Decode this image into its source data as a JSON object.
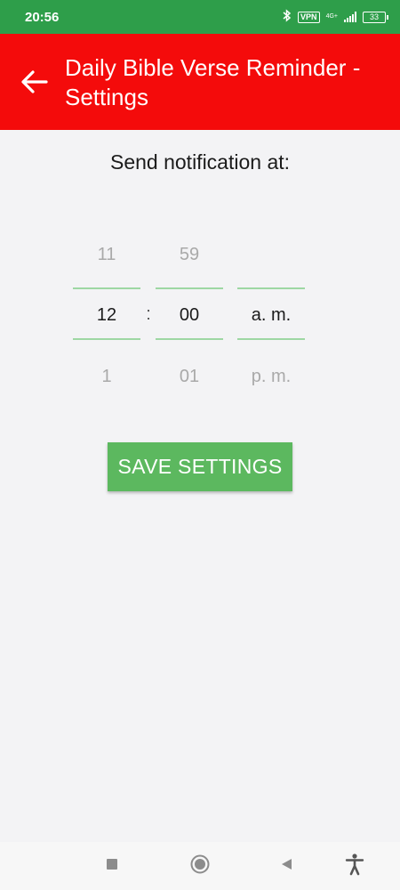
{
  "status_bar": {
    "time": "20:56",
    "vpn": "VPN",
    "network": "4G+",
    "battery": "33",
    "icons": [
      "bluetooth-icon",
      "vpn-icon",
      "signal-icon",
      "battery-icon"
    ]
  },
  "app_bar": {
    "title": "Daily Bible Verse Reminder - Settings",
    "back_icon": "arrow-left-icon",
    "color": "#f40b0b"
  },
  "settings": {
    "prompt": "Send notification at:",
    "time_picker": {
      "hour": {
        "prev": "11",
        "current": "12",
        "next": "1"
      },
      "separator": ":",
      "minute": {
        "prev": "59",
        "current": "00",
        "next": "01"
      },
      "period": {
        "prev": "",
        "current": "a. m.",
        "next": "p. m."
      }
    },
    "save_label": "SAVE SETTINGS",
    "save_color": "#5cb85f"
  },
  "nav_bar": {
    "icons": [
      "recents-square-icon",
      "home-circle-icon",
      "back-triangle-icon",
      "accessibility-icon"
    ]
  },
  "colors": {
    "status_bar": "#2e9e4a",
    "background": "#f3f3f5",
    "picker_line": "#9ed7a3"
  }
}
